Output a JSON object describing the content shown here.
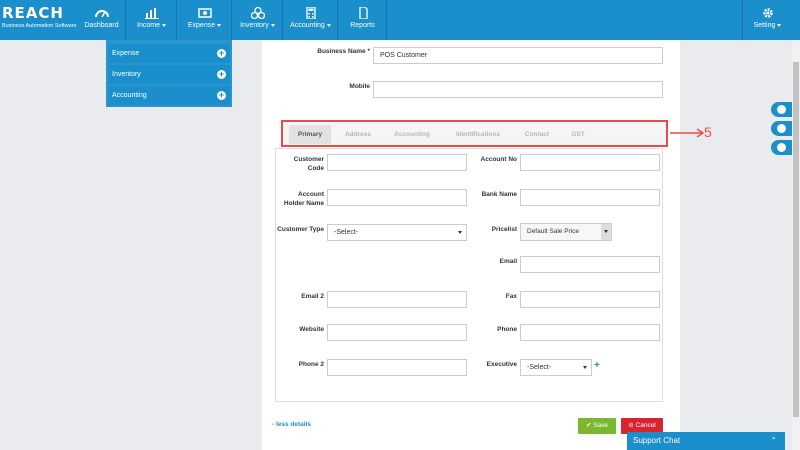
{
  "brand": {
    "name": "REACH",
    "tagline": "Business Automation Software"
  },
  "nav": {
    "dashboard": "Dashboard",
    "income": "Income",
    "expense": "Expense",
    "inventory": "Inventory",
    "accounting": "Accounting",
    "reports": "Reports",
    "setting": "Setting"
  },
  "dropdown": {
    "items": [
      "Expense",
      "Inventory",
      "Accounting"
    ]
  },
  "form": {
    "business_name_label": "Business Name *",
    "business_name_value": "POS Customer",
    "mobile_label": "Mobile",
    "mobile_value": ""
  },
  "tabs": [
    "Primary",
    "Address",
    "Accounting",
    "Identifications",
    "Contact",
    "GST"
  ],
  "annotation": {
    "label": "5"
  },
  "fields": {
    "customer_code": "Customer Code",
    "account_no": "Account No",
    "account_holder": "Account Holder Name",
    "bank_name": "Bank Name",
    "customer_type": "Customer Type",
    "customer_type_value": "-Select-",
    "pricelist": "Pricelist",
    "pricelist_value": "Default Sale Price",
    "email": "Email",
    "email2": "Email 2",
    "fax": "Fax",
    "website": "Website",
    "phone": "Phone",
    "phone2": "Phone 2",
    "executive": "Executive",
    "executive_value": "-Select-"
  },
  "footer": {
    "less_details": "- less details",
    "save": "Save",
    "cancel": "Cancel"
  },
  "chat": {
    "label": "Support Chat"
  },
  "colors": {
    "primary": "#1a8fcb",
    "save": "#7cb82f",
    "cancel": "#d9232d",
    "highlight": "#e74c4c"
  }
}
